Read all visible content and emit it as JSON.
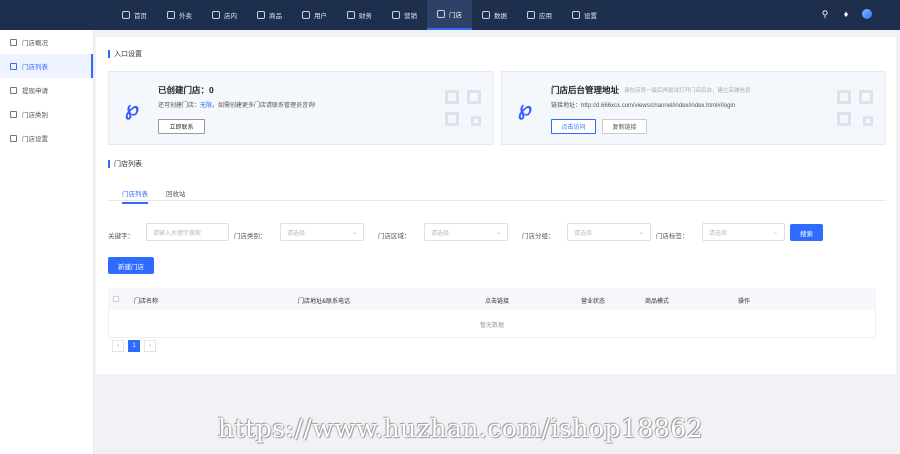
{
  "topnav": {
    "items": [
      {
        "label": "首页",
        "icon": "home-icon"
      },
      {
        "label": "外卖",
        "icon": "takeout-icon"
      },
      {
        "label": "店内",
        "icon": "store-icon"
      },
      {
        "label": "商品",
        "icon": "goods-icon"
      },
      {
        "label": "用户",
        "icon": "user-icon"
      },
      {
        "label": "财务",
        "icon": "finance-icon"
      },
      {
        "label": "营销",
        "icon": "gift-icon"
      },
      {
        "label": "门店",
        "icon": "shop-icon",
        "active": true
      },
      {
        "label": "数据",
        "icon": "data-icon"
      },
      {
        "label": "应用",
        "icon": "app-icon"
      },
      {
        "label": "设置",
        "icon": "settings-icon"
      }
    ]
  },
  "sidebar": {
    "items": [
      {
        "label": "门店概况"
      },
      {
        "label": "门店列表",
        "active": true
      },
      {
        "label": "提现申请"
      },
      {
        "label": "门店类别"
      },
      {
        "label": "门店设置"
      }
    ]
  },
  "entry": {
    "title": "入口设置",
    "card1": {
      "title": "已创建门店：0",
      "text_prefix": "还可创建门店：",
      "text_highlight": "无限",
      "text_suffix": "，如需创建更多门店请联系管理员咨询!",
      "button": "立即联系"
    },
    "card2": {
      "title": "门店后台管理地址",
      "subtitle": "请在店员一级后再尝试打开门店后台，建立店铺信息",
      "link_label": "链接地址：",
      "link_url": "http://d.666xcx.com/views/channel/index/index.html#/login",
      "button_visit": "点击访问",
      "button_copy": "复制链接"
    }
  },
  "list": {
    "title": "门店列表",
    "tabs": [
      "门店列表",
      "回收站"
    ]
  },
  "filters": {
    "keyword_label": "关键字：",
    "keyword_placeholder": "请输入关键字搜索",
    "category_label": "门店类别：",
    "area_label": "门店区域：",
    "group_label": "门店分组：",
    "tag_label": "门店标签：",
    "select_placeholder": "请选择",
    "search_button": "搜索"
  },
  "new_store_button": "新建门店",
  "table": {
    "columns": [
      "门店名称",
      "门店地址&联系电话",
      "点击链接",
      "营业状态",
      "商品模式",
      "操作"
    ],
    "empty_text": "暂无数据"
  },
  "pagination": {
    "prev": "‹",
    "current": "1",
    "next": "›"
  },
  "watermark": "https://www.huzhan.com/ishop18862"
}
